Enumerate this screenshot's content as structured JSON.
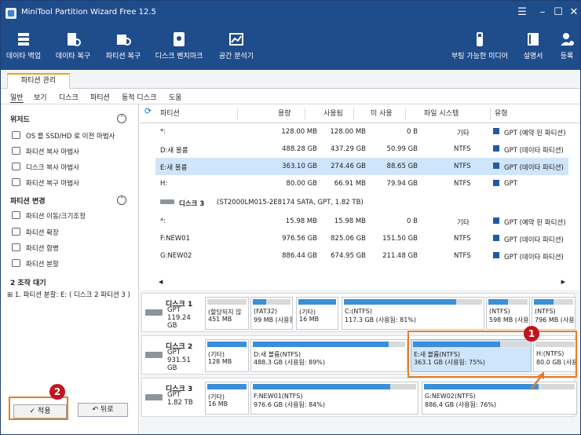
{
  "window": {
    "title": "MiniTool Partition Wizard Free 12.5"
  },
  "toolbar": {
    "items": [
      {
        "label": "데이타 백업",
        "icon": "backup-icon"
      },
      {
        "label": "데이타 복구",
        "icon": "data-recovery-icon"
      },
      {
        "label": "파티션 복구",
        "icon": "partition-recovery-icon"
      },
      {
        "label": "디스크 벤치마크",
        "icon": "disk-benchmark-icon"
      },
      {
        "label": "공간 분석기",
        "icon": "space-analyzer-icon"
      },
      {
        "label": "부팅 가능한 미디어",
        "icon": "bootable-media-icon"
      },
      {
        "label": "설명서",
        "icon": "manual-icon"
      },
      {
        "label": "등록",
        "icon": "register-icon"
      }
    ]
  },
  "tab": {
    "label": "파티션 관리"
  },
  "menu": [
    "일반",
    "보기",
    "디스크",
    "파티션",
    "동적 디스크",
    "도움"
  ],
  "left": {
    "wizard_title": "위저드",
    "wizard_items": [
      "OS 를 SSD/HD 로 이전 마법사",
      "파티션 복사 마법사",
      "디스크 복사 마법사",
      "파티션 복구 마법사"
    ],
    "change_title": "파티션 변경",
    "change_items": [
      "파티션 이동/크기조정",
      "파티션 확장",
      "파티션 합병",
      "파티션 분할"
    ],
    "pending_title": "2 조작 대기",
    "pending_item": "1. 파티션 분할: E: ( 디스크 2 파티션 3 )",
    "apply_label": "✓ 적용",
    "undo_label": "↶ 뒤로"
  },
  "table": {
    "headers": [
      "파티션",
      "용량",
      "사용됨",
      "미 사용",
      "파일 시스템",
      "유형"
    ],
    "rows": [
      {
        "name": "*:",
        "cap": "128.00 MB",
        "used": "128.00 MB",
        "free": "0 B",
        "fs": "기타",
        "type": "GPT (예약 된 파티션)"
      },
      {
        "name": "D:새 볼륨",
        "cap": "488.28 GB",
        "used": "437.29 GB",
        "free": "50.99 GB",
        "fs": "NTFS",
        "type": "GPT (데이타 파티션)"
      },
      {
        "name": "E:새 볼륨",
        "cap": "363.10 GB",
        "used": "274.46 GB",
        "free": "88.65 GB",
        "fs": "NTFS",
        "type": "GPT (데이타 파티션)"
      },
      {
        "name": "H:",
        "cap": "80.00 GB",
        "used": "66.91 MB",
        "free": "79.94 GB",
        "fs": "NTFS",
        "type": "GPT"
      }
    ],
    "disk3_header": "디스크 3",
    "disk3_desc": "(ST2000LM015-2E8174 SATA, GPT, 1.82 TB)",
    "rows3": [
      {
        "name": "*:",
        "cap": "15.98 MB",
        "used": "15.98 MB",
        "free": "0 B",
        "fs": "기타",
        "type": "GPT (예약 된 파티션)"
      },
      {
        "name": "F:NEW01",
        "cap": "976.56 GB",
        "used": "825.06 GB",
        "free": "151.50 GB",
        "fs": "NTFS",
        "type": "GPT (데이타 파티션)"
      },
      {
        "name": "G:NEW02",
        "cap": "886.44 GB",
        "used": "674.95 GB",
        "free": "211.48 GB",
        "fs": "NTFS",
        "type": "GPT (데이타 파티션)"
      }
    ]
  },
  "disks": [
    {
      "name": "디스크 1",
      "style": "GPT",
      "size": "119.24 GB",
      "parts": [
        {
          "t1": "(할당되지 않",
          "t2": "451 MB",
          "use": 0
        },
        {
          "t1": "(FAT32)",
          "t2": "99 MB (사용됨:",
          "use": 0.35
        },
        {
          "t1": "(기타)",
          "t2": "16 MB",
          "use": 1
        },
        {
          "t1": "C:(NTFS)",
          "t2": "117.3 GB (사용됨: 81%)",
          "use": 0.81
        },
        {
          "t1": "(NTFS)",
          "t2": "598 MB (사용",
          "use": 0.5
        },
        {
          "t1": "(NTFS)",
          "t2": "796 MB (사용",
          "use": 0.5
        }
      ]
    },
    {
      "name": "디스크 2",
      "style": "GPT",
      "size": "931.51 GB",
      "parts": [
        {
          "t1": "(기타)",
          "t2": "128 MB",
          "use": 1
        },
        {
          "t1": "D:새 볼륨(NTFS)",
          "t2": "488.3 GB (사용됨: 89%)",
          "use": 0.89
        },
        {
          "t1": "E:새 볼륨(NTFS)",
          "t2": "363.1 GB (사용됨: 75%)",
          "use": 0.75
        },
        {
          "t1": "H:(NTFS)",
          "t2": "80.0 GB (사용",
          "use": 0
        }
      ]
    },
    {
      "name": "디스크 3",
      "style": "GPT",
      "size": "1.82 TB",
      "parts": [
        {
          "t1": "(기타)",
          "t2": "16 MB",
          "use": 1
        },
        {
          "t1": "F:NEW01(NTFS)",
          "t2": "976.6 GB (사용됨: 84%)",
          "use": 0.84
        },
        {
          "t1": "G:NEW02(NTFS)",
          "t2": "886.4 GB (사용됨: 76%)",
          "use": 0.76
        }
      ]
    }
  ],
  "badges": {
    "b1": "1",
    "b2": "2"
  },
  "colors": {
    "titlebar": "#1f4c8b",
    "bar_fill": "#3a8fd9",
    "highlight": "#e67e22",
    "badge": "#c0151f"
  }
}
